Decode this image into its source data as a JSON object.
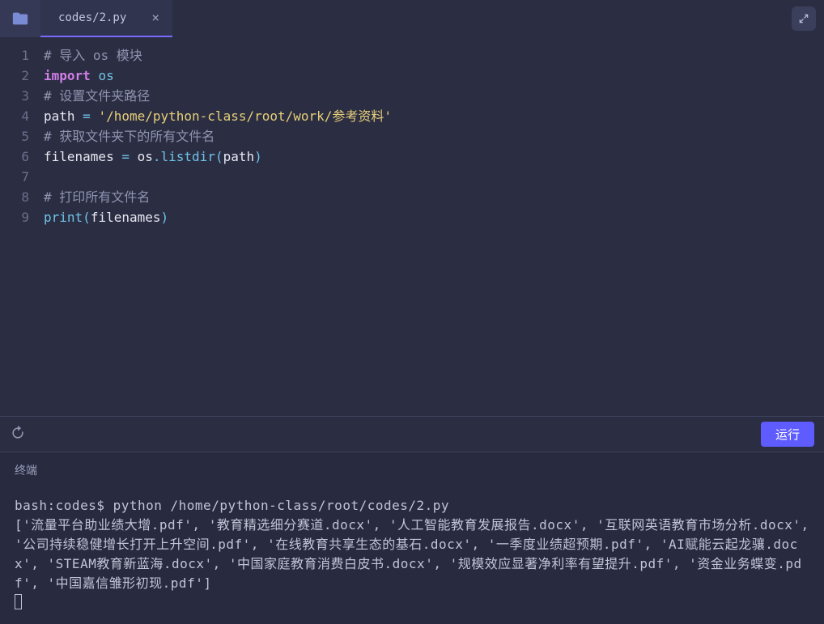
{
  "tab": {
    "filename": "codes/2.py",
    "close_glyph": "×"
  },
  "gutter_lines": [
    "1",
    "2",
    "3",
    "4",
    "5",
    "6",
    "7",
    "8",
    "9"
  ],
  "code": {
    "c1": "# 导入 os 模块",
    "kw_import": "import",
    "mod_os": "os",
    "c2": "# 设置文件夹路径",
    "id_path": "path",
    "op_eq": " = ",
    "str_path": "'/home/python-class/root/work/参考资料'",
    "c3": "# 获取文件夹下的所有文件名",
    "id_filenames": "filenames",
    "id_os": "os",
    "dot": ".",
    "fn_listdir": "listdir",
    "lp": "(",
    "rp": ")",
    "c4": "# 打印所有文件名",
    "fn_print": "print"
  },
  "actionbar": {
    "run_label": "运行"
  },
  "terminal": {
    "title": "终端",
    "prompt": "bash:codes$ ",
    "command": "python /home/python-class/root/codes/2.py",
    "output": "['流量平台助业绩大增.pdf', '教育精选细分赛道.docx', '人工智能教育发展报告.docx', '互联网英语教育市场分析.docx', '公司持续稳健增长打开上升空间.pdf', '在线教育共享生态的基石.docx', '一季度业绩超预期.pdf', 'AI赋能云起龙骧.docx', 'STEAM教育新蓝海.docx', '中国家庭教育消费白皮书.docx', '规模效应显著净利率有望提升.pdf', '资金业务蝶变.pdf', '中国嘉信雏形初现.pdf']"
  }
}
